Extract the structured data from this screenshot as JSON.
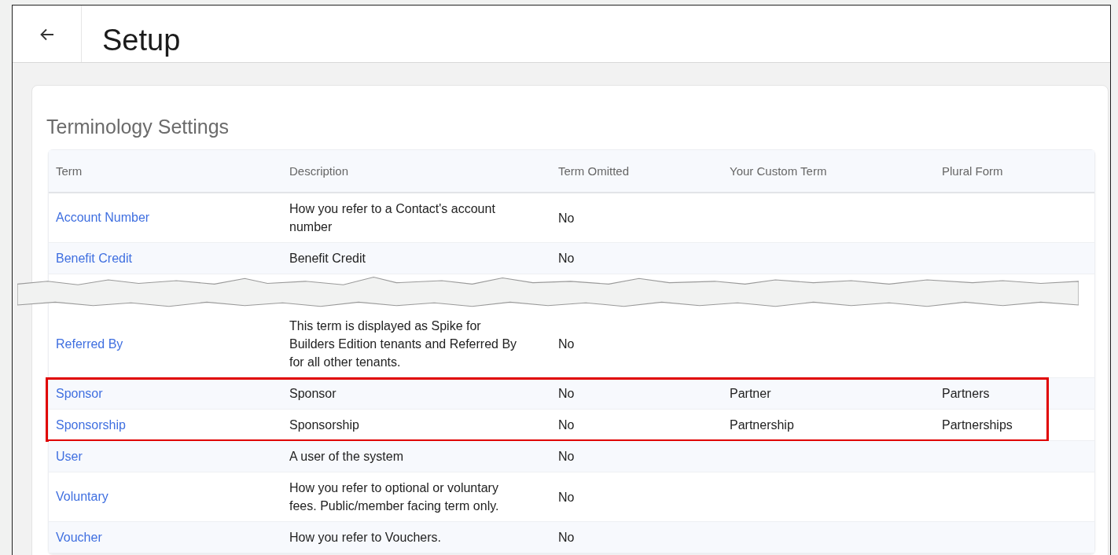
{
  "header": {
    "title": "Setup"
  },
  "card": {
    "title": "Terminology Settings"
  },
  "table": {
    "columns": [
      "Term",
      "Description",
      "Term Omitted",
      "Your Custom Term",
      "Plural Form"
    ],
    "rows": [
      {
        "kind": "row",
        "term": "Account Number",
        "description": "How you refer to a Contact's account number",
        "omitted": "No",
        "highlighted": false
      },
      {
        "kind": "row",
        "term": "Benefit Credit",
        "description": "Benefit Credit",
        "omitted": "No",
        "highlighted": false
      },
      {
        "kind": "tear"
      },
      {
        "kind": "row",
        "term": "Referred By",
        "description": "This term is displayed as Spike for Builders Edition tenants and Referred By for all other tenants.",
        "omitted": "No",
        "highlighted": false
      },
      {
        "kind": "row",
        "term": "Sponsor",
        "description": "Sponsor",
        "omitted": "No",
        "custom": "Partner",
        "plural": "Partners",
        "highlighted": true
      },
      {
        "kind": "row",
        "term": "Sponsorship",
        "description": "Sponsorship",
        "omitted": "No",
        "custom": "Partnership",
        "plural": "Partnerships",
        "highlighted": true
      },
      {
        "kind": "row",
        "term": "User",
        "description": "A user of the system",
        "omitted": "No",
        "highlighted": false
      },
      {
        "kind": "row",
        "term": "Voluntary",
        "description": "How you refer to optional or voluntary fees. Public/member facing term only.",
        "omitted": "No",
        "highlighted": false
      },
      {
        "kind": "row",
        "term": "Voucher",
        "description": "How you refer to Vouchers.",
        "omitted": "No",
        "highlighted": false
      }
    ]
  }
}
